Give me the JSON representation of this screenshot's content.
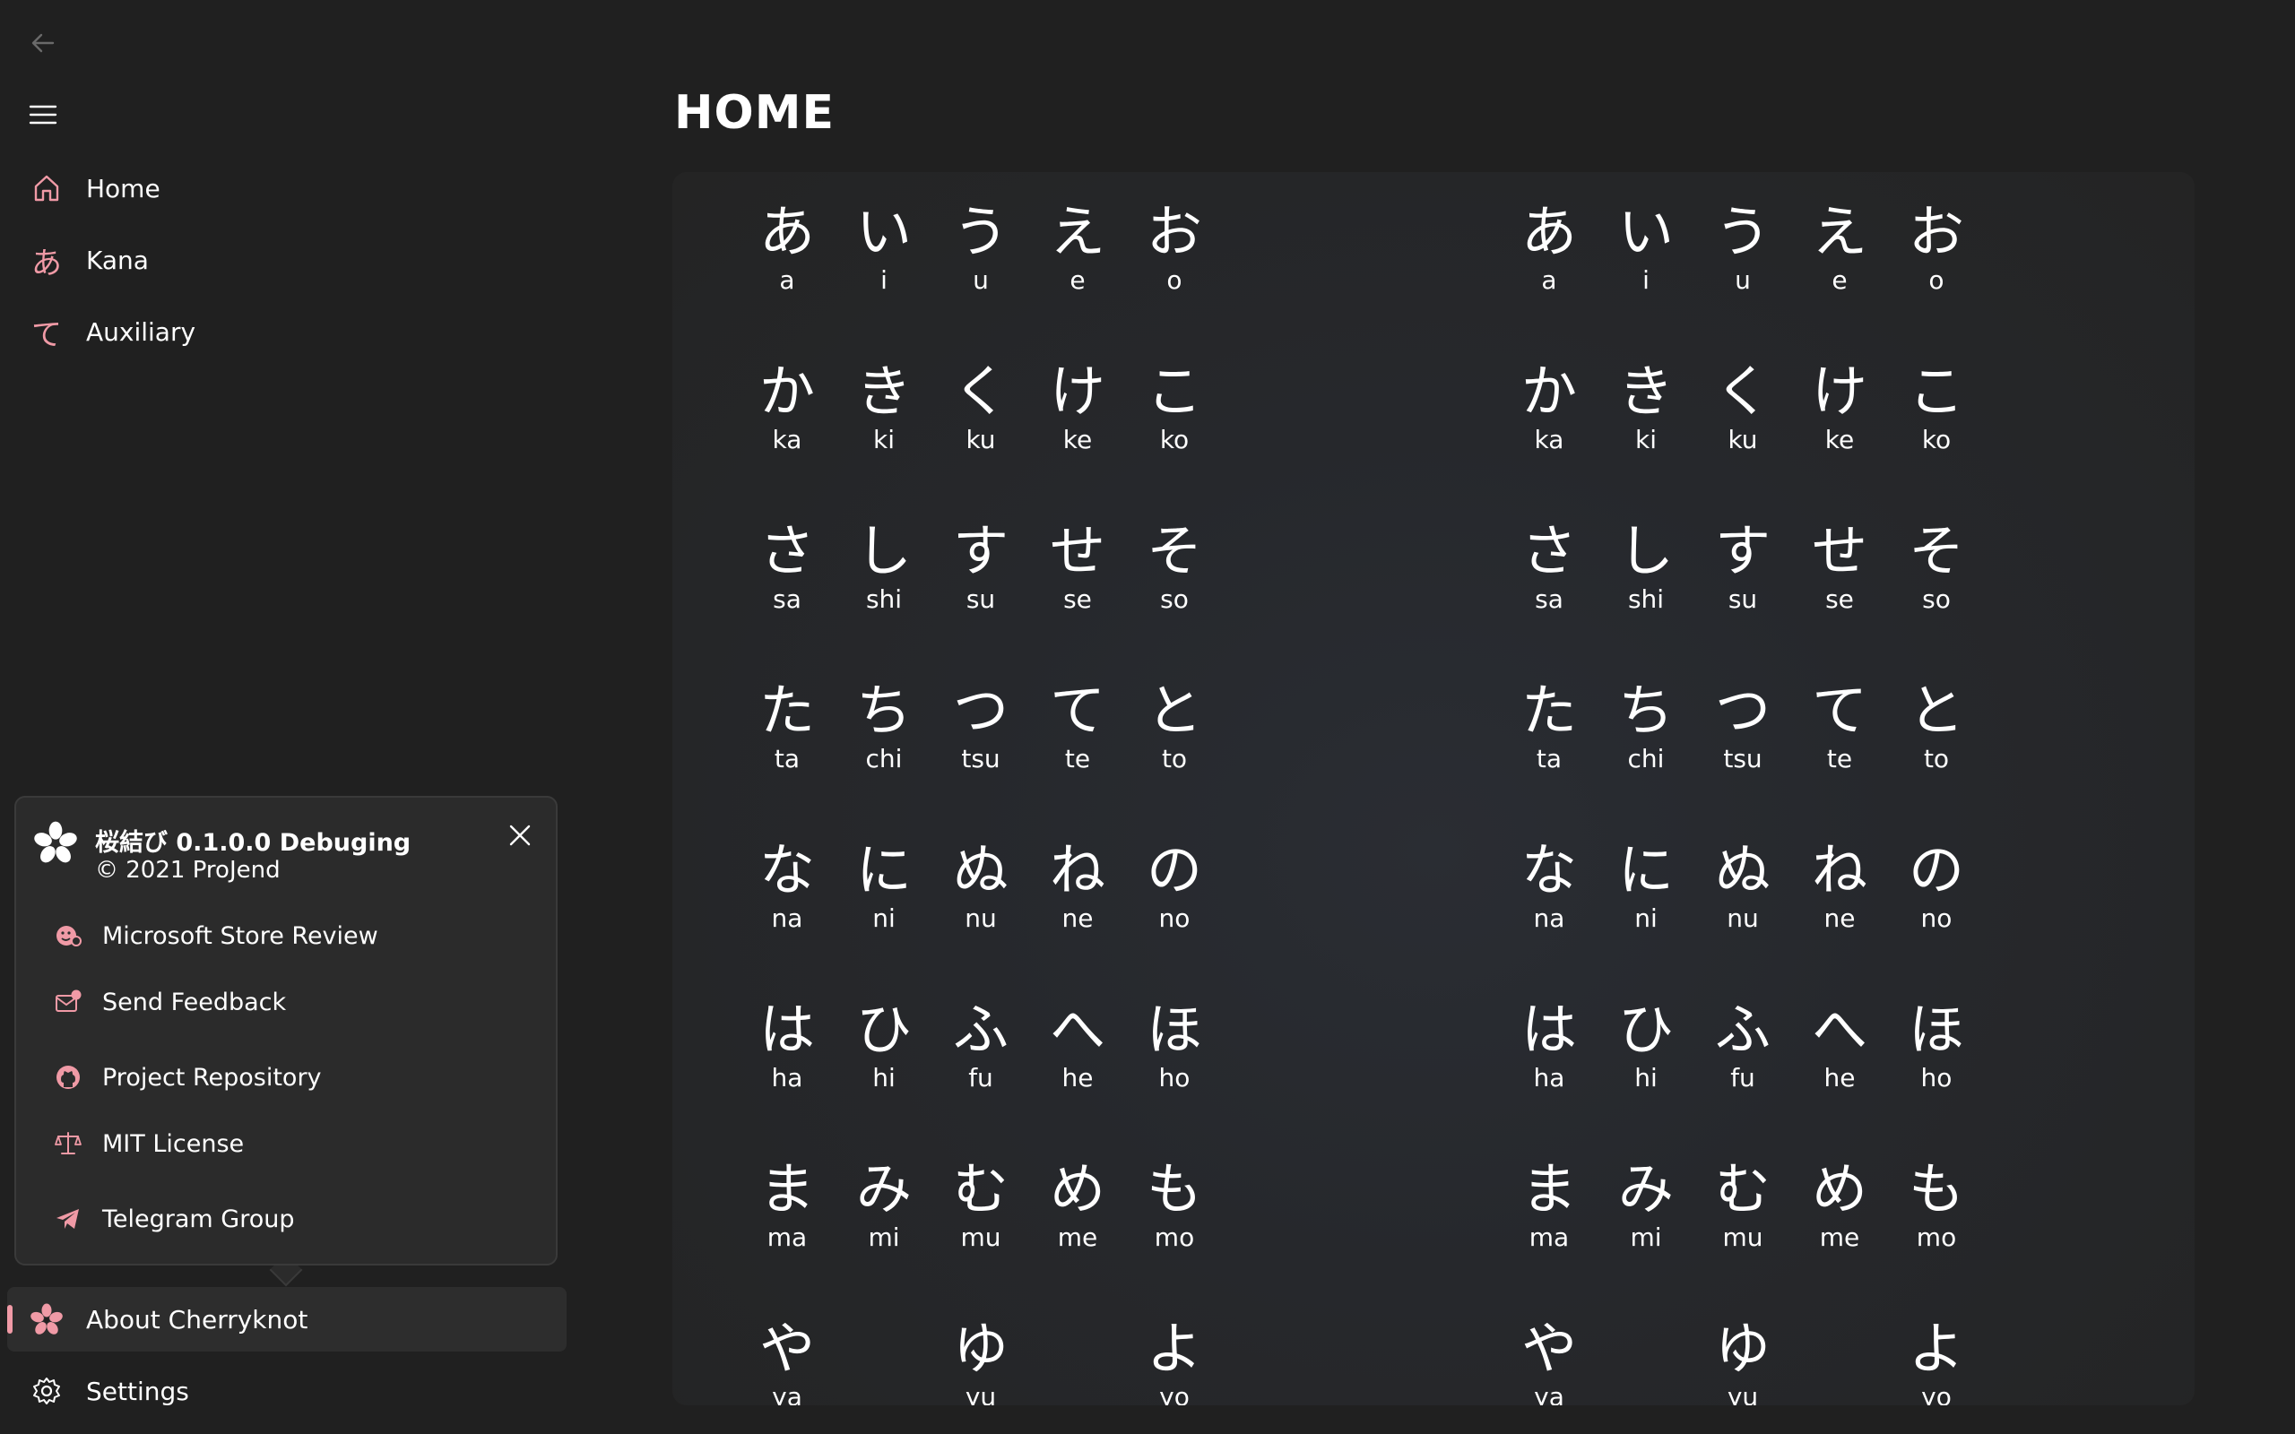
{
  "nav": {
    "back_icon": "back-arrow-icon",
    "menu_icon": "hamburger-icon",
    "items": [
      {
        "label": "Home",
        "icon": "home-icon"
      },
      {
        "label": "Kana",
        "icon": "あ"
      },
      {
        "label": "Auxiliary",
        "icon": "て"
      }
    ],
    "footer": [
      {
        "label": "About Cherryknot",
        "icon": "cherry-blossom-icon"
      },
      {
        "label": "Settings",
        "icon": "gear-icon"
      }
    ]
  },
  "flyout": {
    "title": "桜結び 0.1.0.0 Debuging",
    "copyright": "© 2021 ProJend",
    "items": [
      {
        "label": "Microsoft Store Review",
        "icon": "store-review-icon"
      },
      {
        "label": "Send Feedback",
        "icon": "feedback-icon"
      },
      {
        "label": "Project Repository",
        "icon": "github-icon"
      },
      {
        "label": "MIT License",
        "icon": "scale-icon"
      },
      {
        "label": "Telegram Group",
        "icon": "telegram-icon"
      }
    ]
  },
  "page": {
    "title": "HOME"
  },
  "kana_rows": [
    [
      [
        "あ",
        "a"
      ],
      [
        "い",
        "i"
      ],
      [
        "う",
        "u"
      ],
      [
        "え",
        "e"
      ],
      [
        "お",
        "o"
      ]
    ],
    [
      [
        "か",
        "ka"
      ],
      [
        "き",
        "ki"
      ],
      [
        "く",
        "ku"
      ],
      [
        "け",
        "ke"
      ],
      [
        "こ",
        "ko"
      ]
    ],
    [
      [
        "さ",
        "sa"
      ],
      [
        "し",
        "shi"
      ],
      [
        "す",
        "su"
      ],
      [
        "せ",
        "se"
      ],
      [
        "そ",
        "so"
      ]
    ],
    [
      [
        "た",
        "ta"
      ],
      [
        "ち",
        "chi"
      ],
      [
        "つ",
        "tsu"
      ],
      [
        "て",
        "te"
      ],
      [
        "と",
        "to"
      ]
    ],
    [
      [
        "な",
        "na"
      ],
      [
        "に",
        "ni"
      ],
      [
        "ぬ",
        "nu"
      ],
      [
        "ね",
        "ne"
      ],
      [
        "の",
        "no"
      ]
    ],
    [
      [
        "は",
        "ha"
      ],
      [
        "ひ",
        "hi"
      ],
      [
        "ふ",
        "fu"
      ],
      [
        "へ",
        "he"
      ],
      [
        "ほ",
        "ho"
      ]
    ],
    [
      [
        "ま",
        "ma"
      ],
      [
        "み",
        "mi"
      ],
      [
        "む",
        "mu"
      ],
      [
        "め",
        "me"
      ],
      [
        "も",
        "mo"
      ]
    ],
    [
      [
        "や",
        "ya"
      ],
      [
        "",
        ""
      ],
      [
        "ゆ",
        "yu"
      ],
      [
        "",
        ""
      ],
      [
        "よ",
        "yo"
      ]
    ]
  ],
  "colors": {
    "accent": "#f09aa6",
    "background": "#202020",
    "card": "#26282c"
  }
}
